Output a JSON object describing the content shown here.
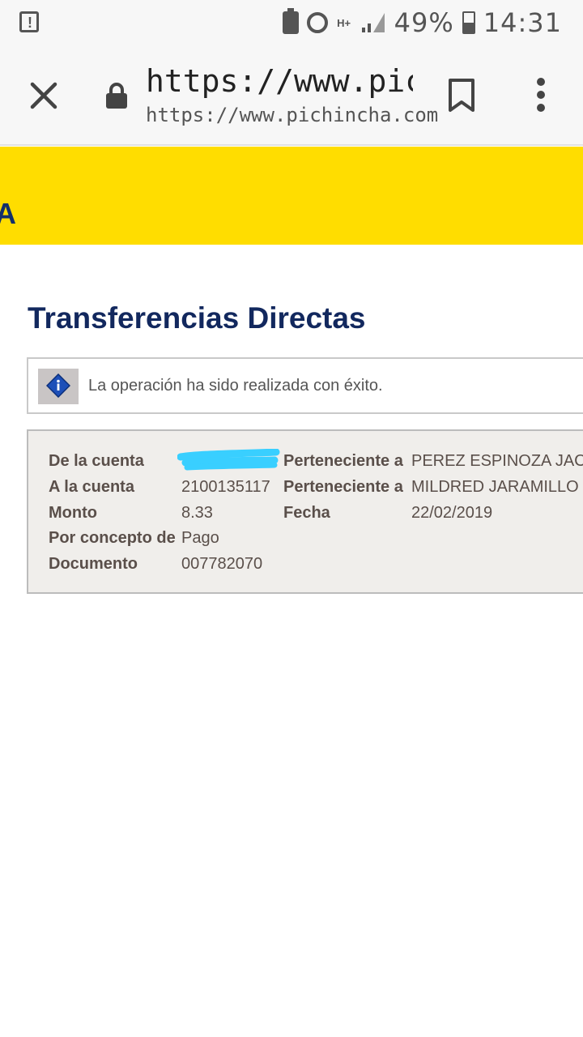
{
  "status_bar": {
    "alert_glyph": "!",
    "network": "H+",
    "battery_percent": "49%",
    "time": "14:31",
    "icons": [
      "alert-icon",
      "battery-saver-icon",
      "alarm-icon",
      "signal-icon",
      "battery-icon"
    ]
  },
  "browser": {
    "url_title": "https://www.pich...",
    "url": "https://www.pichincha.com",
    "icons": [
      "close-icon",
      "lock-icon",
      "bookmark-icon",
      "more-vert-icon"
    ]
  },
  "banner": {
    "color": "#ffdd00",
    "partial_text": "A"
  },
  "page": {
    "title": "Transferencias Directas",
    "title_color": "#12285e"
  },
  "info": {
    "icon": "info-icon",
    "message": "La operación ha sido realizada con éxito."
  },
  "details": {
    "from_account_label": "De la cuenta",
    "from_account_value": "",
    "from_owner_label": "Perteneciente a",
    "from_owner_value": "PEREZ ESPINOZA JAC",
    "to_account_label": "A la cuenta",
    "to_account_value": "2100135117",
    "to_owner_label": "Perteneciente a",
    "to_owner_value": "MILDRED JARAMILLO /",
    "amount_label": "Monto",
    "amount_value": "8.33",
    "date_label": "Fecha",
    "date_value": "22/02/2019",
    "concept_label": "Por concepto de",
    "concept_value": "Pago",
    "document_label": "Documento",
    "document_value": "007782070",
    "redaction_color": "#39cfff"
  }
}
